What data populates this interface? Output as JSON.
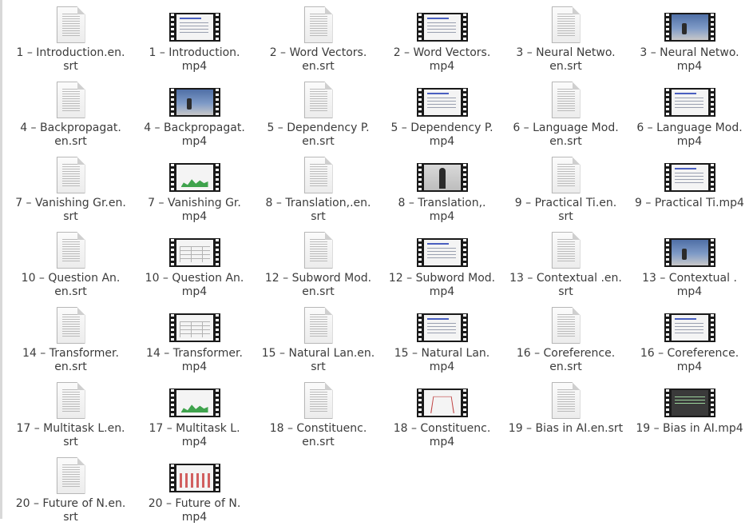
{
  "files": [
    {
      "type": "srt",
      "line1": "1 – Introduction.en.",
      "line2": "srt",
      "icon": "text-file-icon"
    },
    {
      "type": "mp4",
      "line1": "1 – Introduction.",
      "line2": "mp4",
      "icon": "video-file-icon",
      "thumb": "slide"
    },
    {
      "type": "srt",
      "line1": "2 – Word Vectors.",
      "line2": "en.srt",
      "icon": "text-file-icon"
    },
    {
      "type": "mp4",
      "line1": "2 – Word Vectors.",
      "line2": "mp4",
      "icon": "video-file-icon",
      "thumb": "slide"
    },
    {
      "type": "srt",
      "line1": "3 – Neural Netwo.",
      "line2": "en.srt",
      "icon": "text-file-icon"
    },
    {
      "type": "mp4",
      "line1": "3 – Neural Netwo.",
      "line2": "mp4",
      "icon": "video-file-icon",
      "thumb": "lecture"
    },
    {
      "type": "srt",
      "line1": "4 – Backpropagat.",
      "line2": "en.srt",
      "icon": "text-file-icon"
    },
    {
      "type": "mp4",
      "line1": "4 – Backpropagat.",
      "line2": "mp4",
      "icon": "video-file-icon",
      "thumb": "lecture"
    },
    {
      "type": "srt",
      "line1": "5 – Dependency P.",
      "line2": "en.srt",
      "icon": "text-file-icon"
    },
    {
      "type": "mp4",
      "line1": "5 – Dependency P.",
      "line2": "mp4",
      "icon": "video-file-icon",
      "thumb": "slide"
    },
    {
      "type": "srt",
      "line1": "6 – Language Mod.",
      "line2": "en.srt",
      "icon": "text-file-icon"
    },
    {
      "type": "mp4",
      "line1": "6 – Language Mod.",
      "line2": "mp4",
      "icon": "video-file-icon",
      "thumb": "slide"
    },
    {
      "type": "srt",
      "line1": "7 – Vanishing Gr.en.",
      "line2": "srt",
      "icon": "text-file-icon"
    },
    {
      "type": "mp4",
      "line1": "7 – Vanishing Gr.",
      "line2": "mp4",
      "icon": "video-file-icon",
      "thumb": "chart"
    },
    {
      "type": "srt",
      "line1": "8 – Translation,.en.",
      "line2": "srt",
      "icon": "text-file-icon"
    },
    {
      "type": "mp4",
      "line1": "8 – Translation,.",
      "line2": "mp4",
      "icon": "video-file-icon",
      "thumb": "person"
    },
    {
      "type": "srt",
      "line1": "9 – Practical Ti.en.",
      "line2": "srt",
      "icon": "text-file-icon"
    },
    {
      "type": "mp4",
      "line1": "9 – Practical Ti.mp4",
      "line2": "",
      "icon": "video-file-icon",
      "thumb": "slide"
    },
    {
      "type": "srt",
      "line1": "10 – Question An.",
      "line2": "en.srt",
      "icon": "text-file-icon"
    },
    {
      "type": "mp4",
      "line1": "10 – Question An.",
      "line2": "mp4",
      "icon": "video-file-icon",
      "thumb": "table"
    },
    {
      "type": "srt",
      "line1": "12 – Subword Mod.",
      "line2": "en.srt",
      "icon": "text-file-icon"
    },
    {
      "type": "mp4",
      "line1": "12 – Subword Mod.",
      "line2": "mp4",
      "icon": "video-file-icon",
      "thumb": "slide"
    },
    {
      "type": "srt",
      "line1": "13 – Contextual .en.",
      "line2": "srt",
      "icon": "text-file-icon"
    },
    {
      "type": "mp4",
      "line1": "13 – Contextual .",
      "line2": "mp4",
      "icon": "video-file-icon",
      "thumb": "lecture"
    },
    {
      "type": "srt",
      "line1": "14 – Transformer.",
      "line2": "en.srt",
      "icon": "text-file-icon"
    },
    {
      "type": "mp4",
      "line1": "14 – Transformer.",
      "line2": "mp4",
      "icon": "video-file-icon",
      "thumb": "table"
    },
    {
      "type": "srt",
      "line1": "15 – Natural Lan.en.",
      "line2": "srt",
      "icon": "text-file-icon"
    },
    {
      "type": "mp4",
      "line1": "15 – Natural Lan.",
      "line2": "mp4",
      "icon": "video-file-icon",
      "thumb": "slide"
    },
    {
      "type": "srt",
      "line1": "16 – Coreference.",
      "line2": "en.srt",
      "icon": "text-file-icon"
    },
    {
      "type": "mp4",
      "line1": "16 – Coreference.",
      "line2": "mp4",
      "icon": "video-file-icon",
      "thumb": "slide"
    },
    {
      "type": "srt",
      "line1": "17 – Multitask L.en.",
      "line2": "srt",
      "icon": "text-file-icon"
    },
    {
      "type": "mp4",
      "line1": "17 – Multitask L.",
      "line2": "mp4",
      "icon": "video-file-icon",
      "thumb": "chart"
    },
    {
      "type": "srt",
      "line1": "18 – Constituenc.",
      "line2": "en.srt",
      "icon": "text-file-icon"
    },
    {
      "type": "mp4",
      "line1": "18 – Constituenc.",
      "line2": "mp4",
      "icon": "video-file-icon",
      "thumb": "tree"
    },
    {
      "type": "srt",
      "line1": "19 – Bias in AI.en.srt",
      "line2": "",
      "icon": "text-file-icon"
    },
    {
      "type": "mp4",
      "line1": "19 – Bias in AI.mp4",
      "line2": "",
      "icon": "video-file-icon",
      "thumb": "dark"
    },
    {
      "type": "srt",
      "line1": "20 – Future of N.en.",
      "line2": "srt",
      "icon": "text-file-icon"
    },
    {
      "type": "mp4",
      "line1": "20 – Future of N.",
      "line2": "mp4",
      "icon": "video-file-icon",
      "thumb": "redgrid"
    }
  ]
}
